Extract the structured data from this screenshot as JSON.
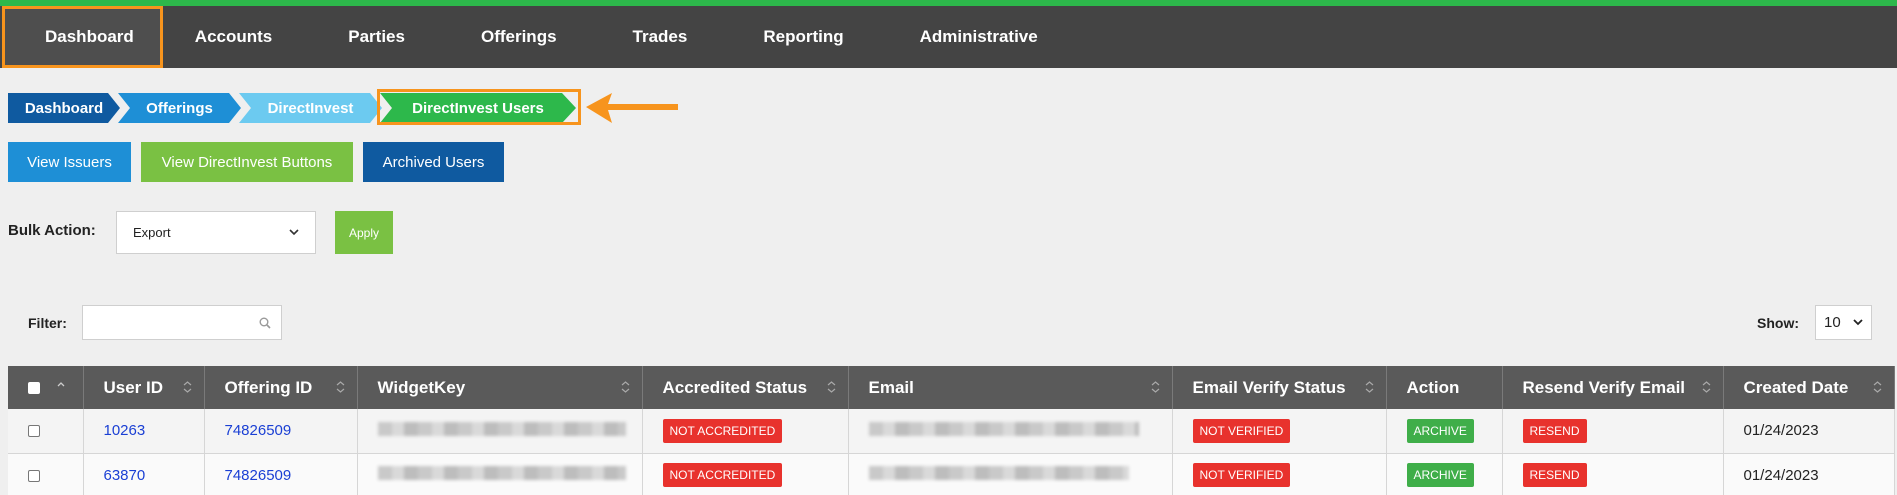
{
  "nav": {
    "items": [
      {
        "label": "Dashboard"
      },
      {
        "label": "Accounts"
      },
      {
        "label": "Parties"
      },
      {
        "label": "Offerings"
      },
      {
        "label": "Trades"
      },
      {
        "label": "Reporting"
      },
      {
        "label": "Administrative"
      }
    ]
  },
  "breadcrumb": {
    "items": [
      {
        "label": "Dashboard",
        "color": "#0f5aa0"
      },
      {
        "label": "Offerings",
        "color": "#1e8fd6"
      },
      {
        "label": "DirectInvest",
        "color": "#6ccaf0"
      },
      {
        "label": "DirectInvest Users",
        "color": "#2db84b"
      }
    ]
  },
  "buttons": {
    "view_issuers": "View Issuers",
    "view_directinvest_buttons": "View DirectInvest Buttons",
    "archived_users": "Archived Users"
  },
  "bulk": {
    "label": "Bulk Action:",
    "selected": "Export",
    "apply": "Apply"
  },
  "filter": {
    "label": "Filter:",
    "value": ""
  },
  "show": {
    "label": "Show:",
    "selected": "10"
  },
  "table": {
    "columns": [
      "User ID",
      "Offering ID",
      "WidgetKey",
      "Accredited Status",
      "Email",
      "Email Verify Status",
      "Action",
      "Resend Verify Email",
      "Created Date"
    ],
    "rows": [
      {
        "user_id": "10263",
        "offering_id": "74826509",
        "accredited": "NOT ACCREDITED",
        "verify": "NOT VERIFIED",
        "action": "ARCHIVE",
        "resend": "RESEND",
        "created": "01/24/2023"
      },
      {
        "user_id": "63870",
        "offering_id": "74826509",
        "accredited": "NOT ACCREDITED",
        "verify": "NOT VERIFIED",
        "action": "ARCHIVE",
        "resend": "RESEND",
        "created": "01/24/2023"
      }
    ]
  },
  "colors": {
    "accent_orange": "#f7941d",
    "top_stripe": "#2db84b",
    "badge_red": "#e8322d",
    "badge_green": "#3fae49"
  }
}
